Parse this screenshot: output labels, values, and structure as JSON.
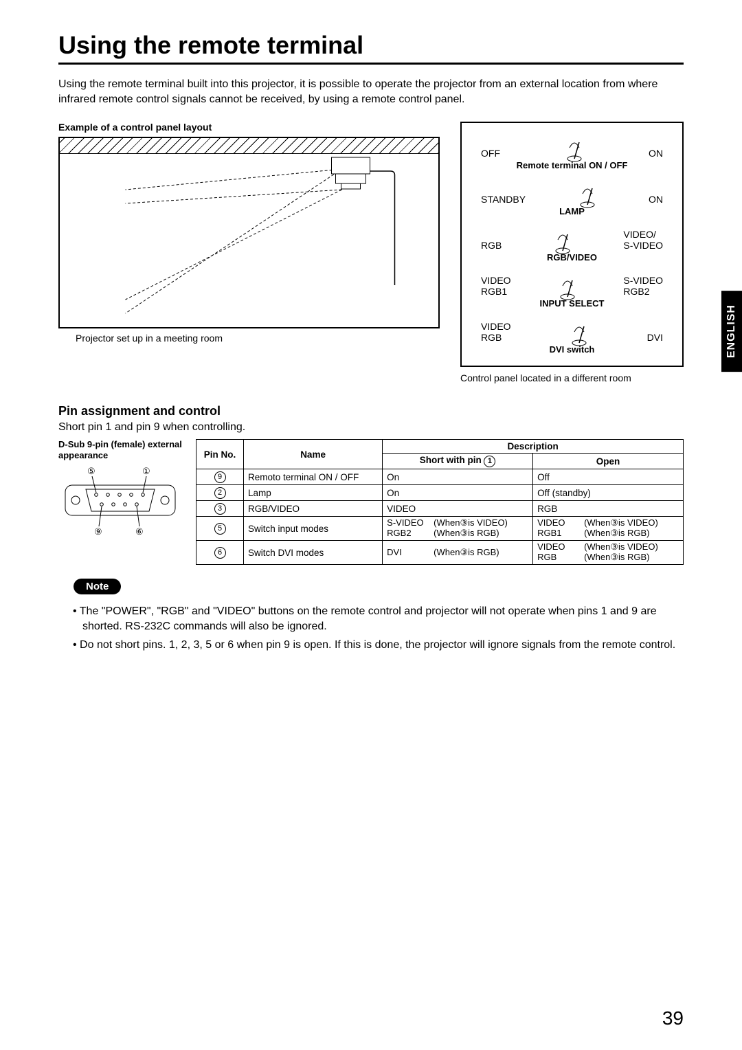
{
  "title": "Using the remote terminal",
  "intro": "Using the remote terminal built into this projector, it is possible to operate the projector from an external location from where infrared remote control signals cannot be received, by using a remote control panel.",
  "example_heading": "Example of a control panel layout",
  "room_caption": "Projector set up in a meeting room",
  "panel_caption": "Control panel located in a different room",
  "language_tab": "ENGLISH",
  "panel": {
    "rows": [
      {
        "left": "OFF",
        "right": "ON",
        "label": "Remote terminal  ON / OFF"
      },
      {
        "left": "STANDBY",
        "right": "ON",
        "label": "LAMP"
      },
      {
        "left": "RGB",
        "right": "VIDEO/\nS-VIDEO",
        "label": "RGB/VIDEO"
      },
      {
        "left": "VIDEO\nRGB1",
        "right": "S-VIDEO\nRGB2",
        "label": "INPUT SELECT"
      },
      {
        "left": "VIDEO\nRGB",
        "right": "DVI",
        "label": "DVI switch"
      }
    ]
  },
  "pin_section_heading": "Pin assignment and control",
  "pin_short_note": "Short pin 1 and pin 9 when controlling.",
  "connector_heading": "D-Sub 9-pin (female) external appearance",
  "connector_labels": {
    "topLeft": "5",
    "topRight": "1",
    "botLeft": "9",
    "botRight": "6"
  },
  "table": {
    "headers": {
      "pin": "Pin No.",
      "name": "Name",
      "desc": "Description",
      "short": "Short with pin ",
      "short_num": "1",
      "open": "Open"
    },
    "rows": [
      {
        "pin": "9",
        "name": "Remoto terminal ON / OFF",
        "short": "On",
        "open": "Off"
      },
      {
        "pin": "2",
        "name": "Lamp",
        "short": "On",
        "open": "Off (standby)"
      },
      {
        "pin": "3",
        "name": "RGB/VIDEO",
        "short": "VIDEO",
        "open": "RGB"
      },
      {
        "pin": "5",
        "name": "Switch input modes",
        "short_rows": [
          {
            "a": "S-VIDEO",
            "b": "(When③is VIDEO)"
          },
          {
            "a": "RGB2",
            "b": "(When③is RGB)"
          }
        ],
        "open_rows": [
          {
            "a": "VIDEO",
            "b": "(When③is VIDEO)"
          },
          {
            "a": "RGB1",
            "b": "(When③is RGB)"
          }
        ]
      },
      {
        "pin": "6",
        "name": "Switch DVI modes",
        "short_rows": [
          {
            "a": "DVI",
            "b": "(When③is RGB)"
          }
        ],
        "open_rows": [
          {
            "a": "VIDEO",
            "b": "(When③is VIDEO)"
          },
          {
            "a": "RGB",
            "b": "(When③is RGB)"
          }
        ]
      }
    ]
  },
  "note_label": "Note",
  "notes": [
    "The \"POWER\", \"RGB\" and \"VIDEO\" buttons on the remote control and projector will not operate when pins 1 and 9 are shorted. RS-232C commands will also be ignored.",
    "Do not short pins. 1, 2, 3, 5 or 6 when pin 9 is open. If this is done, the projector will ignore signals from the remote control."
  ],
  "page_number": "39"
}
